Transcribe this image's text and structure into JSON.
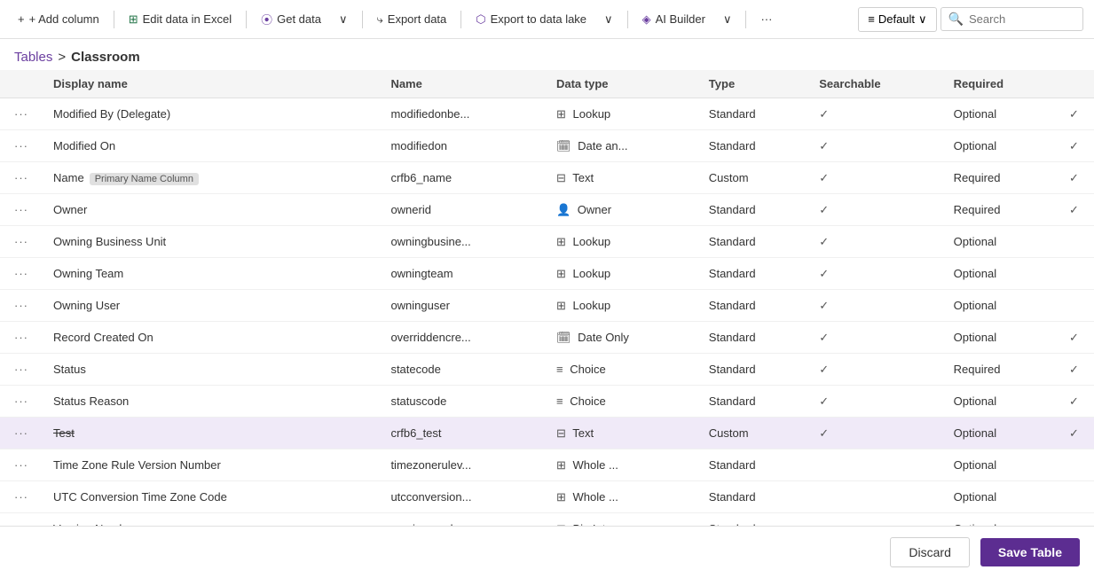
{
  "toolbar": {
    "add_column": "+ Add column",
    "edit_excel": "Edit data in Excel",
    "get_data": "Get data",
    "export_data": "Export data",
    "export_lake": "Export to data lake",
    "ai_builder": "AI Builder",
    "more": "···",
    "default": "Default",
    "search": "Search"
  },
  "breadcrumb": {
    "parent": "Tables",
    "separator": ">",
    "current": "Classroom"
  },
  "columns": {
    "headers": [
      "",
      "Display name",
      "",
      "Name",
      "Data type",
      "Type",
      "Searchable",
      "Required"
    ]
  },
  "rows": [
    {
      "name": "Modified By (Delegate)",
      "logical": "modifiedonbe...",
      "datatype": "Lookup",
      "type": "Standard",
      "searchable": true,
      "required": "Optional",
      "has_check2": true,
      "strikethrough": false,
      "selected": false
    },
    {
      "name": "Modified On",
      "logical": "modifiedon",
      "datatype": "Date an...",
      "type": "Standard",
      "searchable": true,
      "required": "Optional",
      "has_check2": true,
      "strikethrough": false,
      "selected": false
    },
    {
      "name": "Name",
      "badge": "Primary Name Column",
      "logical": "crfb6_name",
      "datatype": "Text",
      "type": "Custom",
      "searchable": true,
      "required": "Required",
      "has_check2": true,
      "strikethrough": false,
      "selected": false
    },
    {
      "name": "Owner",
      "logical": "ownerid",
      "datatype": "Owner",
      "type": "Standard",
      "searchable": true,
      "required": "Required",
      "has_check2": true,
      "strikethrough": false,
      "selected": false
    },
    {
      "name": "Owning Business Unit",
      "logical": "owningbusine...",
      "datatype": "Lookup",
      "type": "Standard",
      "searchable": true,
      "required": "Optional",
      "has_check2": false,
      "strikethrough": false,
      "selected": false
    },
    {
      "name": "Owning Team",
      "logical": "owningteam",
      "datatype": "Lookup",
      "type": "Standard",
      "searchable": true,
      "required": "Optional",
      "has_check2": false,
      "strikethrough": false,
      "selected": false
    },
    {
      "name": "Owning User",
      "logical": "owninguser",
      "datatype": "Lookup",
      "type": "Standard",
      "searchable": true,
      "required": "Optional",
      "has_check2": false,
      "strikethrough": false,
      "selected": false
    },
    {
      "name": "Record Created On",
      "logical": "overriddencre...",
      "datatype": "Date Only",
      "type": "Standard",
      "searchable": true,
      "required": "Optional",
      "has_check2": true,
      "strikethrough": false,
      "selected": false
    },
    {
      "name": "Status",
      "logical": "statecode",
      "datatype": "Choice",
      "type": "Standard",
      "searchable": true,
      "required": "Required",
      "has_check2": true,
      "strikethrough": false,
      "selected": false
    },
    {
      "name": "Status Reason",
      "logical": "statuscode",
      "datatype": "Choice",
      "type": "Standard",
      "searchable": true,
      "required": "Optional",
      "has_check2": true,
      "strikethrough": false,
      "selected": false
    },
    {
      "name": "Test",
      "logical": "crfb6_test",
      "datatype": "Text",
      "type": "Custom",
      "searchable": true,
      "required": "Optional",
      "has_check2": true,
      "strikethrough": true,
      "selected": true
    },
    {
      "name": "Time Zone Rule Version Number",
      "logical": "timezonerulev...",
      "datatype": "Whole ...",
      "type": "Standard",
      "searchable": false,
      "required": "Optional",
      "has_check2": false,
      "strikethrough": false,
      "selected": false
    },
    {
      "name": "UTC Conversion Time Zone Code",
      "logical": "utcconversion...",
      "datatype": "Whole ...",
      "type": "Standard",
      "searchable": false,
      "required": "Optional",
      "has_check2": false,
      "strikethrough": false,
      "selected": false
    },
    {
      "name": "Version Number",
      "logical": "versionnumber",
      "datatype": "Big Inte...",
      "type": "Standard",
      "searchable": false,
      "required": "Optional",
      "has_check2": false,
      "strikethrough": false,
      "selected": false
    }
  ],
  "footer": {
    "discard": "Discard",
    "save": "Save Table"
  },
  "icons": {
    "add": "+",
    "excel": "⊞",
    "data": "⦿",
    "export": "→",
    "lake": "⬡",
    "ai": "◈",
    "more": "•••",
    "default": "≡",
    "search": "🔍",
    "chevron": "∨",
    "check": "✓",
    "lookup": "⊞",
    "text": "⊟",
    "date": "📅",
    "choice": "≡",
    "owner": "👤",
    "whole": "⊞",
    "bigint": "⊞"
  },
  "type_icons": {
    "Lookup": "⊞",
    "Date an...": "📅",
    "Date Only": "📅",
    "Text": "⊟",
    "Owner": "👤",
    "Choice": "≡",
    "Whole ...": "⊞",
    "Big Inte...": "⊞"
  }
}
